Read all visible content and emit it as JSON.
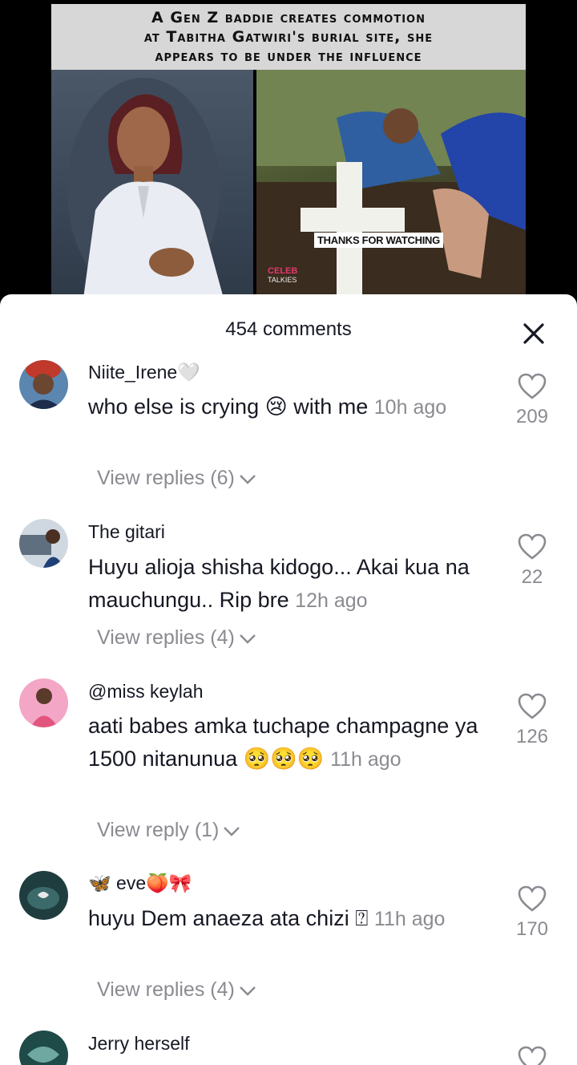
{
  "video": {
    "headline_lines": [
      "A Gen Z baddie creates commotion",
      "at Tabitha Gatwiri's burial site, she",
      "appears to be under the influence"
    ],
    "overlay_label": "THANKS FOR WATCHING",
    "logo_top": "CELEB",
    "logo_bottom": "TALKIES"
  },
  "sheet": {
    "title": "454 comments",
    "close_icon": "close-icon"
  },
  "comments": [
    {
      "username": "Niite_Irene🤍",
      "text": "who else is crying 😢 with me",
      "time": "10h ago",
      "likes": "209",
      "replies": "View replies (6)"
    },
    {
      "username": "The gitari",
      "text": "Huyu alioja shisha kidogo... Akai kua na mauchungu.. Rip bre",
      "time": "12h ago",
      "likes": "22",
      "replies": "View replies (4)"
    },
    {
      "username": "@miss keylah",
      "text": "aati babes amka tuchape champagne ya 1500 nitanunua 🥺🥺🥺",
      "time": "11h ago",
      "likes": "126",
      "replies": "View reply (1)"
    },
    {
      "username": "🦋 eve🍑🎀",
      "text": "huyu Dem anaeza ata chizi ⍰",
      "time": "11h ago",
      "likes": "170",
      "replies": "View replies (4)"
    },
    {
      "username": "Jerry herself",
      "text": "",
      "time": "",
      "likes": "",
      "replies": ""
    }
  ]
}
